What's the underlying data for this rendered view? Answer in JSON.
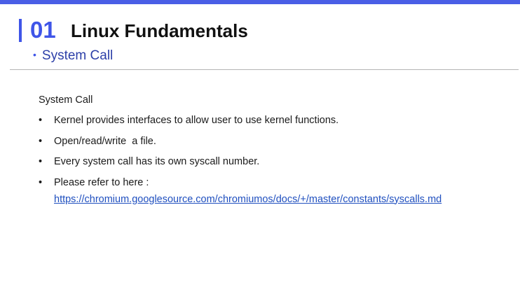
{
  "header": {
    "section_number": "01",
    "title": "Linux Fundamentals",
    "subtitle_bullet": "•",
    "subtitle": "System Call",
    "accent_color": "#3f55e8",
    "top_bar_color": "#4a5ee6"
  },
  "content": {
    "heading": "System Call",
    "bullet_symbol": "•",
    "bullets": [
      {
        "text": "Kernel provides interfaces to allow user to use kernel functions."
      },
      {
        "text": "Open/read/write  a file."
      },
      {
        "text": "Every system call has its own syscall number."
      },
      {
        "text": "Please refer to here :"
      }
    ],
    "link": "https://chromium.googlesource.com/chromiumos/docs/+/master/constants/syscalls.md"
  }
}
